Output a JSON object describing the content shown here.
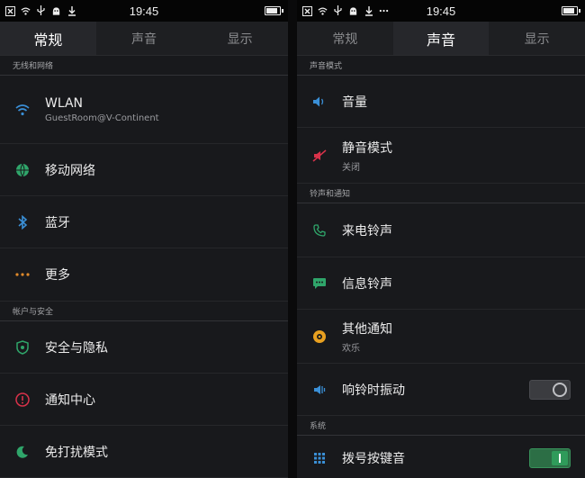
{
  "statusbar": {
    "time": "19:45"
  },
  "left": {
    "tabs": [
      {
        "label": "常规",
        "active": true
      },
      {
        "label": "声音",
        "active": false
      },
      {
        "label": "显示",
        "active": false
      }
    ],
    "section_network": "无线和网络",
    "wlan": {
      "title": "WLAN",
      "sub": "GuestRoom@V-Continent"
    },
    "mobile": {
      "title": "移动网络"
    },
    "bluetooth": {
      "title": "蓝牙"
    },
    "more": {
      "title": "更多"
    },
    "section_account": "帐户与安全",
    "security": {
      "title": "安全与隐私"
    },
    "notify": {
      "title": "通知中心"
    },
    "dnd": {
      "title": "免打扰模式"
    }
  },
  "right": {
    "tabs": [
      {
        "label": "常规",
        "active": false
      },
      {
        "label": "声音",
        "active": true
      },
      {
        "label": "显示",
        "active": false
      }
    ],
    "section_sound": "声音模式",
    "volume": {
      "title": "音量"
    },
    "silent": {
      "title": "静音模式",
      "sub": "关闭"
    },
    "section_ringtone": "铃声和通知",
    "call_ringtone": {
      "title": "来电铃声"
    },
    "msg_ringtone": {
      "title": "信息铃声"
    },
    "other_notify": {
      "title": "其他通知",
      "sub": "欢乐"
    },
    "vibrate": {
      "title": "响铃时振动",
      "enabled": false
    },
    "section_system": "系统",
    "dialpad": {
      "title": "拨号按键音",
      "enabled": true
    }
  },
  "colors": {
    "wifi": "#3a8fd6",
    "globe": "#2fa56a",
    "bluetooth": "#3a8fd6",
    "more": "#e08a2a",
    "shield": "#2fa56a",
    "notify": "#d8324a",
    "moon": "#2fa56a",
    "volume": "#3a8fd6",
    "silent": "#d8324a",
    "phone": "#2fa56a",
    "chat": "#2fa56a",
    "other": "#e8a020",
    "vibrate": "#3a8fd6",
    "dialpad": "#3a8fd6",
    "toggle_on": "#2f9b5a"
  }
}
